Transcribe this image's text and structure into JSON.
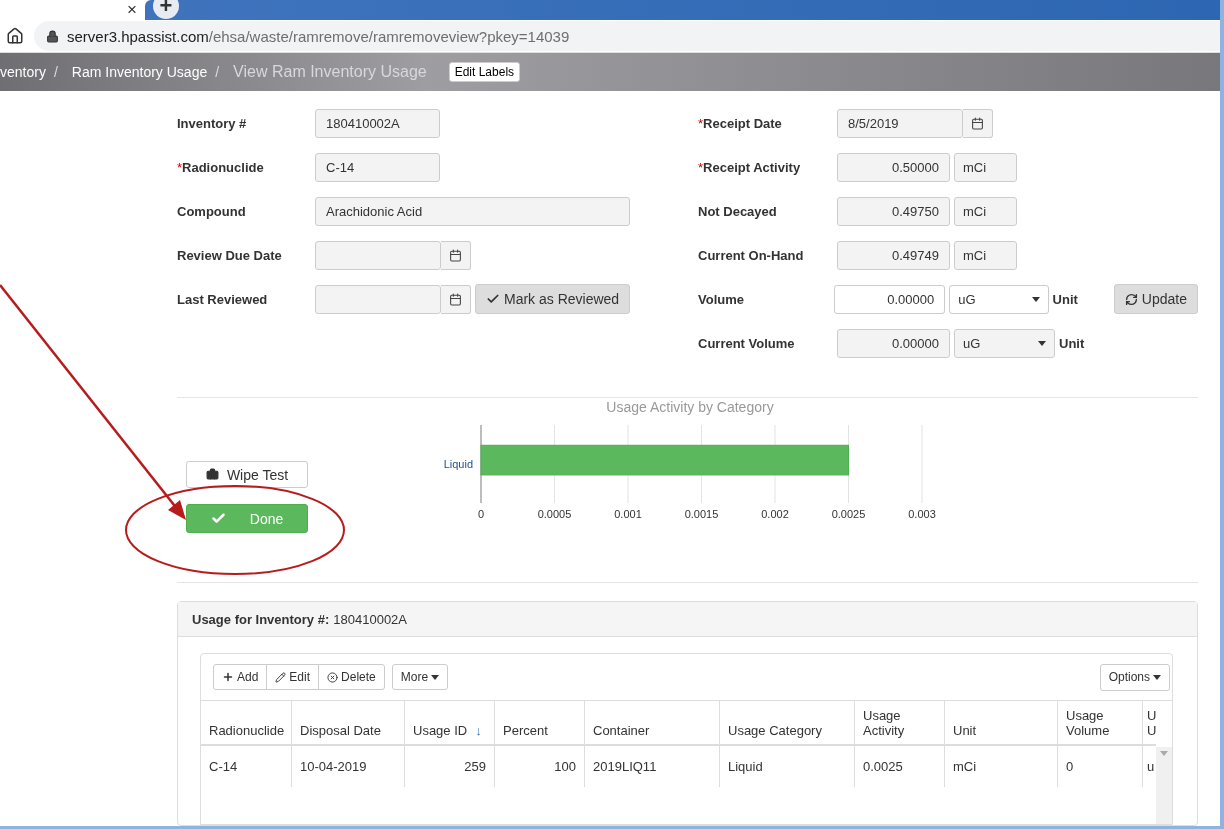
{
  "browser": {
    "tab_close": "×",
    "new_tab": "+",
    "url_host": "server3.hpassist.com",
    "url_path": "/ehsa/waste/ramremove/ramremoveview?pkey=14039"
  },
  "breadcrumb": {
    "items": [
      {
        "label": "ventory",
        "separator": "/"
      },
      {
        "label": "Ram Inventory Usage",
        "separator": "/"
      }
    ],
    "current": "View Ram Inventory Usage",
    "edit_button": "Edit Labels"
  },
  "form_left": [
    {
      "label": "Inventory #",
      "kind": "text",
      "value": "180410002A"
    },
    {
      "label": "Radionuclide",
      "required_mark": "*",
      "kind": "text",
      "value": "C-14"
    },
    {
      "label": "Compound",
      "kind": "wide",
      "value": "Arachidonic Acid"
    },
    {
      "label": "Review Due Date",
      "kind": "date"
    },
    {
      "label": "Last Reviewed",
      "kind": "date",
      "action": "Mark as Reviewed"
    }
  ],
  "form_right": [
    {
      "label": "Receipt Date",
      "required_mark": "*",
      "kind": "date",
      "value": "8/5/2019"
    },
    {
      "label": "Receipt Activity",
      "required_mark": "*",
      "kind": "unit",
      "value": "0.50000",
      "unit": "mCi"
    },
    {
      "label": "Not Decayed",
      "kind": "unit",
      "value": "0.49750",
      "unit": "mCi"
    },
    {
      "label": "Current On-Hand",
      "kind": "unit",
      "value": "0.49749",
      "unit": "mCi"
    },
    {
      "label": "Volume",
      "kind": "select",
      "editable": true,
      "value": "0.00000",
      "unit": "uG",
      "suffix": "Unit",
      "action": "Update"
    },
    {
      "label": "Current Volume",
      "kind": "select",
      "editable": false,
      "value": "0.00000",
      "unit": "uG",
      "suffix": "Unit"
    }
  ],
  "buttons": [
    {
      "label": "Wipe Test",
      "kind": "default"
    },
    {
      "label": "Done",
      "kind": "success"
    }
  ],
  "chart": {
    "chart_data": {
      "type": "bar",
      "orientation": "horizontal",
      "title": "Usage Activity by Category",
      "categories": [
        "Liquid"
      ],
      "series": [
        {
          "color": "#5cb85c",
          "values": [
            0.0025
          ]
        }
      ],
      "grid": true,
      "xlim": [
        0,
        0.003
      ],
      "xticks": [
        {
          "value": 0,
          "label": "0"
        },
        {
          "value": 0.0005,
          "label": "0.0005"
        },
        {
          "value": 0.001,
          "label": "0.001"
        },
        {
          "value": 0.0015,
          "label": "0.0015"
        },
        {
          "value": 0.002,
          "label": "0.002"
        },
        {
          "value": 0.0025,
          "label": "0.0025"
        },
        {
          "value": 0.003,
          "label": "0.003"
        }
      ]
    }
  },
  "usage_panel": {
    "title": "Usage for Inventory #:",
    "inventory": "180410002A",
    "toolbar": [
      {
        "label": "Add",
        "kind": "add"
      },
      {
        "label": "Edit",
        "kind": "edit"
      },
      {
        "label": "Delete",
        "kind": "delete"
      }
    ],
    "more": "More",
    "options": "Options",
    "columns": [
      {
        "label": "Radionuclide"
      },
      {
        "label": "Disposal Date"
      },
      {
        "label": "Usage ID",
        "sort_mark": "↓"
      },
      {
        "label": "Percent"
      },
      {
        "label": "Container"
      },
      {
        "label": "Usage Category"
      },
      {
        "label": "Usage Activity"
      },
      {
        "label": "Unit"
      },
      {
        "label": "Usage Volume"
      },
      {
        "label": "U U"
      }
    ],
    "rows": [
      [
        "C-14",
        "10-04-2019",
        "259",
        "100",
        "2019LIQ11",
        "Liquid",
        "0.0025",
        "mCi",
        "0",
        "u"
      ]
    ]
  }
}
